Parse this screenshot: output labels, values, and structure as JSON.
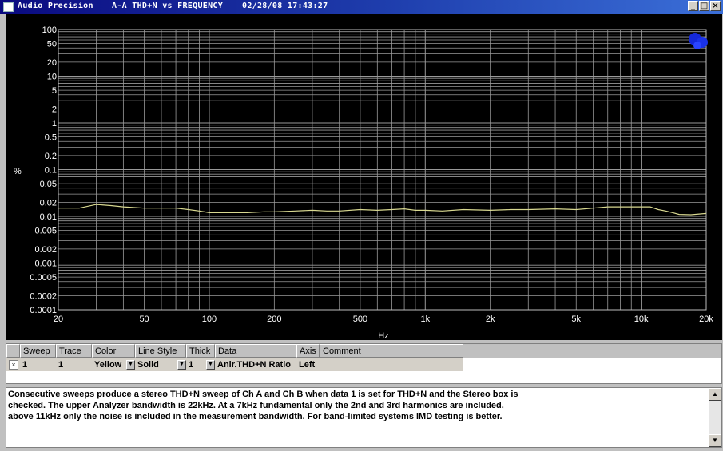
{
  "window": {
    "app_title": "Audio Precision",
    "chart_title": "A-A THD+N vs FREQUENCY",
    "timestamp": "02/28/08 17:43:27",
    "minimize_label": "_",
    "maximize_label": "□",
    "close_label": "×"
  },
  "chart_data": {
    "type": "line",
    "title": "A-A THD+N vs FREQUENCY",
    "xlabel": "Hz",
    "ylabel": "%",
    "xscale": "log",
    "yscale": "log",
    "xlim": [
      20,
      20000
    ],
    "ylim": [
      0.0001,
      100
    ],
    "x_ticks": [
      20,
      50,
      100,
      200,
      500,
      1000,
      2000,
      5000,
      10000,
      20000
    ],
    "x_tick_labels": [
      "20",
      "50",
      "100",
      "200",
      "500",
      "1k",
      "2k",
      "5k",
      "10k",
      "20k"
    ],
    "y_ticks": [
      100,
      50,
      20,
      10,
      5,
      2,
      1,
      0.5,
      0.2,
      0.1,
      0.05,
      0.02,
      0.01,
      0.005,
      0.002,
      0.001,
      0.0005,
      0.0002,
      0.0001
    ],
    "y_tick_labels": [
      "100",
      "50",
      "20",
      "10",
      "5",
      "2",
      "1",
      "0.5",
      "0.2",
      "0.1",
      "0.05",
      "0.02",
      "0.01",
      "0.005",
      "0.002",
      "0.001",
      "0.0005",
      "0.0002",
      "0.0001"
    ],
    "grid": true,
    "background": "#000000",
    "grid_color": "#9a9a9a",
    "series": [
      {
        "color": "#d8d890",
        "x": [
          20,
          25,
          30,
          35,
          40,
          50,
          60,
          70,
          80,
          90,
          100,
          120,
          150,
          180,
          200,
          250,
          300,
          350,
          400,
          500,
          600,
          700,
          800,
          900,
          1000,
          1200,
          1500,
          2000,
          2500,
          3000,
          4000,
          5000,
          6000,
          7000,
          8000,
          9000,
          10000,
          11000,
          12000,
          13000,
          14000,
          15000,
          17000,
          20000
        ],
        "y": [
          0.015,
          0.015,
          0.018,
          0.017,
          0.016,
          0.015,
          0.015,
          0.015,
          0.014,
          0.013,
          0.012,
          0.012,
          0.012,
          0.0125,
          0.0125,
          0.013,
          0.0135,
          0.013,
          0.013,
          0.014,
          0.0135,
          0.014,
          0.0145,
          0.0135,
          0.0135,
          0.013,
          0.014,
          0.0135,
          0.014,
          0.014,
          0.0145,
          0.014,
          0.015,
          0.016,
          0.016,
          0.016,
          0.016,
          0.016,
          0.014,
          0.013,
          0.012,
          0.011,
          0.0108,
          0.0115
        ]
      }
    ]
  },
  "table": {
    "headers": [
      "Sweep",
      "Trace",
      "Color",
      "Line Style",
      "Thick",
      "Data",
      "Axis",
      "Comment"
    ],
    "row": {
      "checked": "×",
      "sweep": "1",
      "trace": "1",
      "color": "Yellow",
      "line_style": "Solid",
      "thick": "1",
      "data": "Anlr.THD+N Ratio",
      "axis": "Left",
      "comment": ""
    }
  },
  "comment": {
    "line1": "Consecutive sweeps produce a stereo THD+N sweep of Ch A and Ch B when data 1 is set for THD+N and the Stereo box is",
    "line2": "checked.  The upper Analyzer bandwidth is 22kHz.  At a 7kHz fundamental only the 2nd and 3rd harmonics are included,",
    "line3": "above 11kHz only the noise is included in the measurement bandwidth.  For band-limited systems IMD testing is better."
  }
}
